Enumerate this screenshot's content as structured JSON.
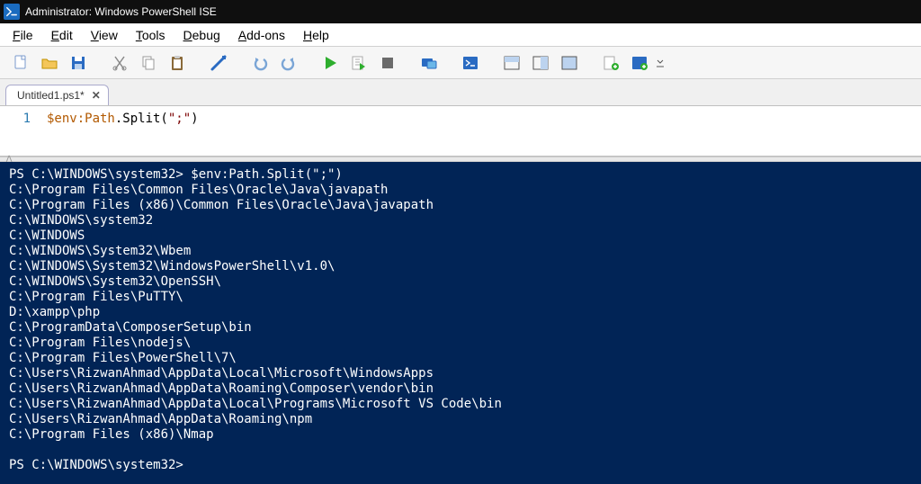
{
  "title": "Administrator: Windows PowerShell ISE",
  "menu": {
    "file": "File",
    "edit": "Edit",
    "view": "View",
    "tools": "Tools",
    "debug": "Debug",
    "addons": "Add-ons",
    "help": "Help"
  },
  "tab": {
    "name": "Untitled1.ps1*",
    "close": "✕"
  },
  "editor": {
    "line_no": "1",
    "var": "$env:Path",
    "call": ".Split(",
    "str": "\";\"",
    "end": ")"
  },
  "console": {
    "prompt1": "PS C:\\WINDOWS\\system32> $env:Path.Split(\";\")",
    "lines": [
      "C:\\Program Files\\Common Files\\Oracle\\Java\\javapath",
      "C:\\Program Files (x86)\\Common Files\\Oracle\\Java\\javapath",
      "C:\\WINDOWS\\system32",
      "C:\\WINDOWS",
      "C:\\WINDOWS\\System32\\Wbem",
      "C:\\WINDOWS\\System32\\WindowsPowerShell\\v1.0\\",
      "C:\\WINDOWS\\System32\\OpenSSH\\",
      "C:\\Program Files\\PuTTY\\",
      "D:\\xampp\\php",
      "C:\\ProgramData\\ComposerSetup\\bin",
      "C:\\Program Files\\nodejs\\",
      "C:\\Program Files\\PowerShell\\7\\",
      "C:\\Users\\RizwanAhmad\\AppData\\Local\\Microsoft\\WindowsApps",
      "C:\\Users\\RizwanAhmad\\AppData\\Roaming\\Composer\\vendor\\bin",
      "C:\\Users\\RizwanAhmad\\AppData\\Local\\Programs\\Microsoft VS Code\\bin",
      "C:\\Users\\RizwanAhmad\\AppData\\Roaming\\npm",
      "C:\\Program Files (x86)\\Nmap"
    ],
    "prompt2": "PS C:\\WINDOWS\\system32> "
  }
}
